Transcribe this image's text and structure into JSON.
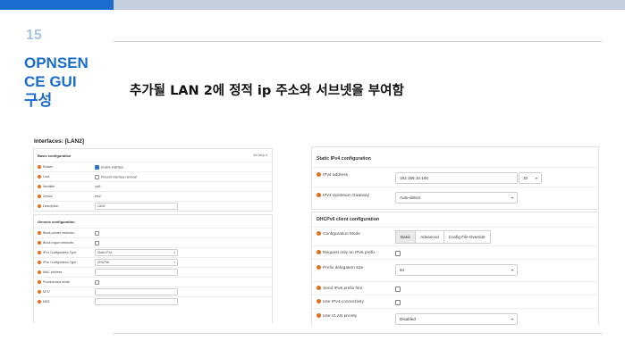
{
  "slide": {
    "number": "15",
    "section_title": "OPNSEN\nCE GUI\n구성",
    "section_lines": [
      "OPNSEN",
      "CE GUI",
      "구성"
    ],
    "heading": "추가될 LAN 2에 정적 ip 주소와 서브넷을 부여함"
  },
  "left_panel": {
    "header": "Interfaces: [LAN2]",
    "basic": {
      "title": "Basic configuration",
      "full_help": "full help",
      "enable_label": "Enable",
      "enable_value": "Enable interface",
      "lock_label": "Lock",
      "lock_value": "Prevent interface removal",
      "identifier_label": "Identifier",
      "identifier_value": "opt1",
      "device_label": "Device",
      "device_value": "em2",
      "description_label": "Description",
      "description_value": "LAN2"
    },
    "generic": {
      "title": "Generic configuration",
      "block_private_label": "Block private networks",
      "block_bogon_label": "Block bogon networks",
      "ipv4_type_label": "IPv4 Configuration Type",
      "ipv4_type_value": "Static IPv4",
      "ipv6_type_label": "IPv6 Configuration Type",
      "ipv6_type_value": "DHCPv6",
      "mac_label": "MAC address",
      "promiscuous_label": "Promiscuous mode",
      "mtu_label": "MTU",
      "mss_label": "MSS"
    }
  },
  "right_panel": {
    "static": {
      "title": "Static IPv4 configuration",
      "ipv4_label": "IPv4 address",
      "ipv4_value": "192.168.10.100",
      "mask_value": "32",
      "gateway_label": "IPv4 Upstream Gateway",
      "gateway_value": "Auto-detect"
    },
    "dhcp6": {
      "title": "DHCPv6 client configuration",
      "mode_label": "Configuration Mode",
      "tabs": [
        "Basic",
        "Advanced",
        "Config File Override"
      ],
      "request_prefix_label": "Request only an IPv6 prefix",
      "prefix_size_label": "Prefix delegation size",
      "prefix_size_value": "64",
      "send_hint_label": "Send IPv6 prefix hint",
      "use_ipv4_label": "Use IPv4 connectivity",
      "vlan_label": "Use VLAN priority",
      "vlan_value": "Disabled"
    }
  },
  "colors": {
    "accent": "#1a6ccf",
    "top_bar_grey": "#c2cfdc",
    "slide_number": "#a9c3e0",
    "help_dot": "#e2701b"
  }
}
